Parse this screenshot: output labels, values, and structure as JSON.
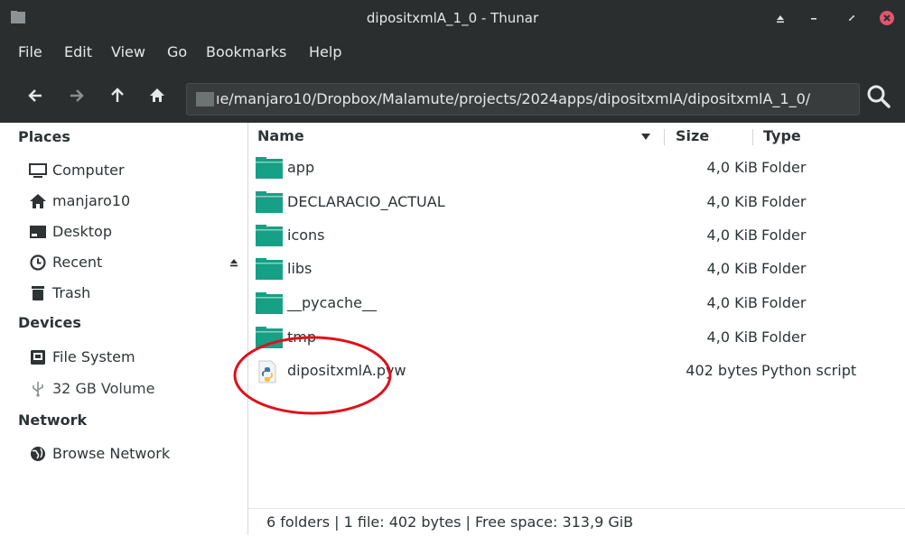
{
  "window": {
    "title": "dipositxmlA_1_0 - Thunar"
  },
  "menu": [
    "File",
    "Edit",
    "View",
    "Go",
    "Bookmarks",
    "Help"
  ],
  "toolbar": {
    "path": "ıe/manjaro10/Dropbox/Malamute/projects/2024apps/dipositxmlA/dipositxmlA_1_0/"
  },
  "sidebar": {
    "places_label": "Places",
    "places": [
      {
        "label": "Computer",
        "icon": "monitor-icon"
      },
      {
        "label": "manjaro10",
        "icon": "home-icon"
      },
      {
        "label": "Desktop",
        "icon": "desktop-icon"
      },
      {
        "label": "Recent",
        "icon": "clock-icon"
      },
      {
        "label": "Trash",
        "icon": "trash-icon"
      }
    ],
    "devices_label": "Devices",
    "devices": [
      {
        "label": "File System",
        "icon": "drive-icon"
      },
      {
        "label": "32 GB Volume",
        "icon": "usb-icon"
      }
    ],
    "network_label": "Network",
    "network": [
      {
        "label": "Browse Network",
        "icon": "globe-icon"
      }
    ]
  },
  "columns": {
    "name": "Name",
    "size": "Size",
    "type": "Type"
  },
  "files": [
    {
      "name": "app",
      "size": "4,0 KiB",
      "type": "Folder",
      "icon": "folder-icon"
    },
    {
      "name": "DECLARACIO_ACTUAL",
      "size": "4,0 KiB",
      "type": "Folder",
      "icon": "folder-icon"
    },
    {
      "name": "icons",
      "size": "4,0 KiB",
      "type": "Folder",
      "icon": "folder-icon"
    },
    {
      "name": "libs",
      "size": "4,0 KiB",
      "type": "Folder",
      "icon": "folder-icon"
    },
    {
      "name": "__pycache__",
      "size": "4,0 KiB",
      "type": "Folder",
      "icon": "folder-icon"
    },
    {
      "name": "tmp",
      "size": "4,0 KiB",
      "type": "Folder",
      "icon": "folder-icon"
    },
    {
      "name": "dipositxmlA.pyw",
      "size": "402 bytes",
      "type": "Python script",
      "icon": "python-file-icon"
    }
  ],
  "status": "6 folders  |  1 file: 402 bytes  |  Free space: 313,9 GiB",
  "colors": {
    "chrome_bg": "#2b2e2f",
    "folder_teal": "#16a085",
    "annotation_red": "#e0101a"
  }
}
